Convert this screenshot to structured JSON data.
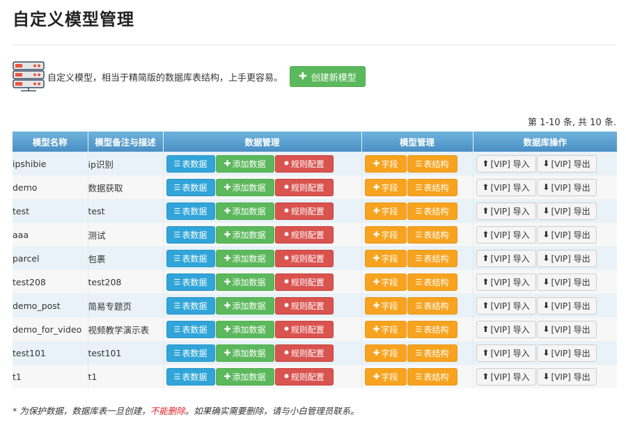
{
  "page": {
    "title": "自定义模型管理",
    "intro_text": "自定义模型，相当于精简版的数据库表结构，上手更容易。",
    "create_button": "创建新模型",
    "summary": "第 1-10 条, 共 10 条."
  },
  "table": {
    "headers": [
      "模型名称",
      "模型备注与描述",
      "数据管理",
      "模型管理",
      "数据库操作"
    ],
    "buttons": {
      "table_data": "表数据",
      "add_data": "添加数据",
      "rule_config": "规则配置",
      "field": "字段",
      "table_struct": "表结构",
      "import": "[VIP] 导入",
      "export": "[VIP] 导出"
    },
    "rows": [
      {
        "name": "ipshibie",
        "desc": "ip识别"
      },
      {
        "name": "demo",
        "desc": "数据获取"
      },
      {
        "name": "test",
        "desc": "test"
      },
      {
        "name": "aaa",
        "desc": "测试"
      },
      {
        "name": "parcel",
        "desc": "包裹"
      },
      {
        "name": "test208",
        "desc": "test208"
      },
      {
        "name": "demo_post",
        "desc": "简易专题页"
      },
      {
        "name": "demo_for_video",
        "desc": "视频教学演示表"
      },
      {
        "name": "test101",
        "desc": "test101"
      },
      {
        "name": "t1",
        "desc": "t1"
      }
    ]
  },
  "note": {
    "before": "* 为保护数据，数据库表一旦创建，",
    "highlight": "不能删除",
    "after": "。如果确实需要删除，请与小白管理员联系。"
  },
  "icons": {
    "server": "server-icon",
    "plus": "plus-icon",
    "list": "list-icon",
    "gear": "gear-icon",
    "upload": "upload-icon",
    "download": "download-icon"
  },
  "colors": {
    "header": "#4a8fc4",
    "info": "#31a5d9",
    "success": "#5cb85c",
    "danger": "#d9534f",
    "warning": "#f7a31f"
  }
}
